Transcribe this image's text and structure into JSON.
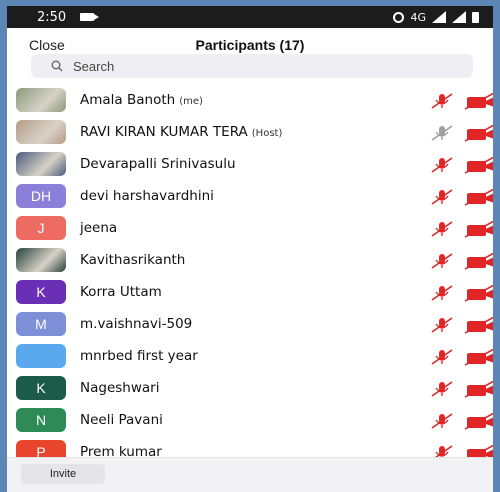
{
  "status_bar": {
    "time": "2:50",
    "network": "4G"
  },
  "header": {
    "close_label": "Close",
    "title": "Participants (17)"
  },
  "search": {
    "placeholder": "Search"
  },
  "participants": [
    {
      "name": "Amala Banoth",
      "tag": "(me)",
      "avatar_type": "photo",
      "avatar_color": "#8a9a7a",
      "mic": "muted",
      "video": "off"
    },
    {
      "name": "RAVI KIRAN KUMAR TERA",
      "tag": "(Host)",
      "avatar_type": "photo",
      "avatar_color": "#b59c86",
      "mic": "muted-gray",
      "video": "off"
    },
    {
      "name": "Devarapalli Srinivasulu",
      "tag": "",
      "avatar_type": "photo",
      "avatar_color": "#4a5a7a",
      "mic": "muted",
      "video": "off"
    },
    {
      "name": "devi harshavardhini",
      "tag": "",
      "avatar_type": "initials",
      "initials": "DH",
      "avatar_color": "#8b7fd9",
      "mic": "muted",
      "video": "off"
    },
    {
      "name": "jeena",
      "tag": "",
      "avatar_type": "initials",
      "initials": "J",
      "avatar_color": "#ee6b62",
      "mic": "muted",
      "video": "off"
    },
    {
      "name": "Kavithasrikanth",
      "tag": "",
      "avatar_type": "photo",
      "avatar_color": "#24413a",
      "mic": "muted",
      "video": "off"
    },
    {
      "name": "Korra Uttam",
      "tag": "",
      "avatar_type": "initials",
      "initials": "K",
      "avatar_color": "#6a2fb6",
      "mic": "muted",
      "video": "off"
    },
    {
      "name": "m.vaishnavi-509",
      "tag": "",
      "avatar_type": "initials",
      "initials": "M",
      "avatar_color": "#7d8fd6",
      "mic": "muted",
      "video": "off"
    },
    {
      "name": "mnrbed first year",
      "tag": "",
      "avatar_type": "initials",
      "initials": "",
      "avatar_color": "#5aa9ee",
      "mic": "muted",
      "video": "off"
    },
    {
      "name": "Nageshwari",
      "tag": "",
      "avatar_type": "initials",
      "initials": "K",
      "avatar_color": "#1c5a49",
      "mic": "muted",
      "video": "off"
    },
    {
      "name": "Neeli Pavani",
      "tag": "",
      "avatar_type": "initials",
      "initials": "N",
      "avatar_color": "#2e8b57",
      "mic": "muted",
      "video": "off"
    },
    {
      "name": "Prem kumar",
      "tag": "",
      "avatar_type": "initials",
      "initials": "P",
      "avatar_color": "#e8452c",
      "mic": "muted",
      "video": "off"
    }
  ],
  "footer": {
    "invite_label": "Invite"
  },
  "colors": {
    "muted_red": "#e02626",
    "muted_gray": "#a0a0a0",
    "page_bg": "#5b86b5"
  }
}
